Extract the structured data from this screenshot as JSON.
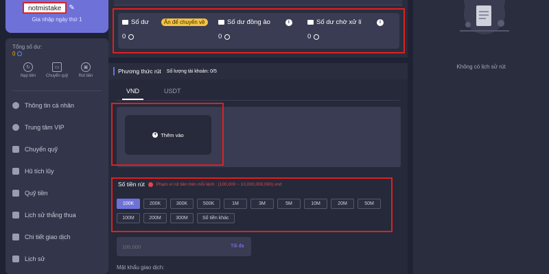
{
  "profile": {
    "username": "notmistake",
    "joined": "Gia nhập ngày thứ 1"
  },
  "sidebar": {
    "balance_label": "Tổng số dư:",
    "balance_value": "0",
    "quick_actions": [
      {
        "label": "Nạp tiền",
        "icon": "deposit-icon"
      },
      {
        "label": "Chuyển quỹ",
        "icon": "wallet-icon"
      },
      {
        "label": "Rút tiền",
        "icon": "withdraw-icon"
      }
    ],
    "menu": [
      {
        "label": "Thông tin cá nhân",
        "icon": "user-icon"
      },
      {
        "label": "Trung tâm VIP",
        "icon": "vip-icon"
      },
      {
        "label": "Chuyển quỹ",
        "icon": "transfer-icon"
      },
      {
        "label": "Hũ tích lũy",
        "icon": "piggy-icon"
      },
      {
        "label": "Quỹ tiền",
        "icon": "fund-icon"
      },
      {
        "label": "Lịch sử thắng thua",
        "icon": "document-icon"
      },
      {
        "label": "Chi tiết giao dịch",
        "icon": "chart-icon"
      },
      {
        "label": "Lịch sử",
        "icon": "history-icon"
      }
    ]
  },
  "balances": {
    "main": {
      "label": "Số dư",
      "value": "0"
    },
    "hide_transfer": "Ấn để chuyển về",
    "virtual": {
      "label": "Số dư đồng ảo",
      "value": "0"
    },
    "pending": {
      "label": "Số dư chờ xử lí",
      "value": "0"
    }
  },
  "withdraw": {
    "title": "Phương thức rút",
    "account_count": "Số lượng tài khoản: 0/5",
    "tabs": [
      {
        "label": "VND",
        "active": true
      },
      {
        "label": "USDT",
        "active": false
      }
    ],
    "add_label": "Thêm vào",
    "amount_label": "Số tiền rút",
    "amount_hint": "Phạm vi rút tiền trên mỗi lệnh : (100,000 ~ 10,000,000,000) vnd",
    "chips": [
      "100K",
      "200K",
      "300K",
      "500K",
      "1M",
      "3M",
      "5M",
      "10M",
      "20M",
      "50M",
      "100M",
      "200M",
      "300M",
      "Số tiền khác"
    ],
    "selected_chip": "100K",
    "amount_placeholder": "100,000",
    "max_label": "Tối đa",
    "password_label": "Mật khẩu giao dịch:"
  },
  "history": {
    "empty": "Không có lịch sử rút"
  },
  "colors": {
    "accent": "#6e72d8",
    "highlight": "#e02020",
    "pill": "#f5c342"
  }
}
